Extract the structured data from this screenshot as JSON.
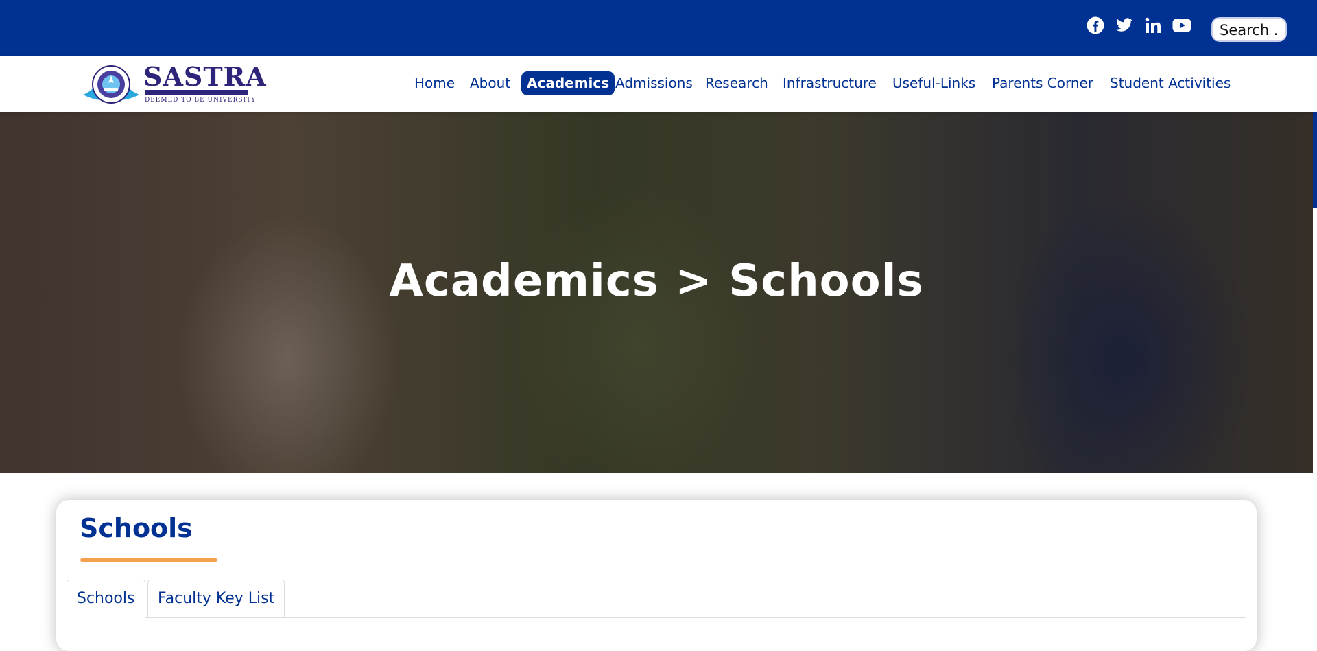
{
  "topbar": {
    "social": [
      {
        "name": "facebook-icon"
      },
      {
        "name": "twitter-icon"
      },
      {
        "name": "linkedin-icon"
      },
      {
        "name": "youtube-icon"
      }
    ],
    "search_text": "Search ."
  },
  "logo": {
    "name": "SASTRA",
    "tagline": "DEEMED TO BE UNIVERSITY"
  },
  "nav": {
    "items": [
      {
        "label": "Home"
      },
      {
        "label": "About"
      },
      {
        "label": "Academics",
        "active": true
      },
      {
        "label": "Admissions"
      },
      {
        "label": "Research"
      },
      {
        "label": "Infrastructure"
      },
      {
        "label": "Useful-Links"
      },
      {
        "label": "Parents Corner"
      },
      {
        "label": "Student Activities"
      }
    ]
  },
  "hero": {
    "title": "Academics > Schools"
  },
  "content": {
    "title": "Schools",
    "tabs": [
      {
        "label": "Schools",
        "active": true
      },
      {
        "label": "Faculty Key List"
      }
    ]
  },
  "colors": {
    "primary": "#003193",
    "accent": "#f5a04e",
    "logo": "#2d2579"
  }
}
